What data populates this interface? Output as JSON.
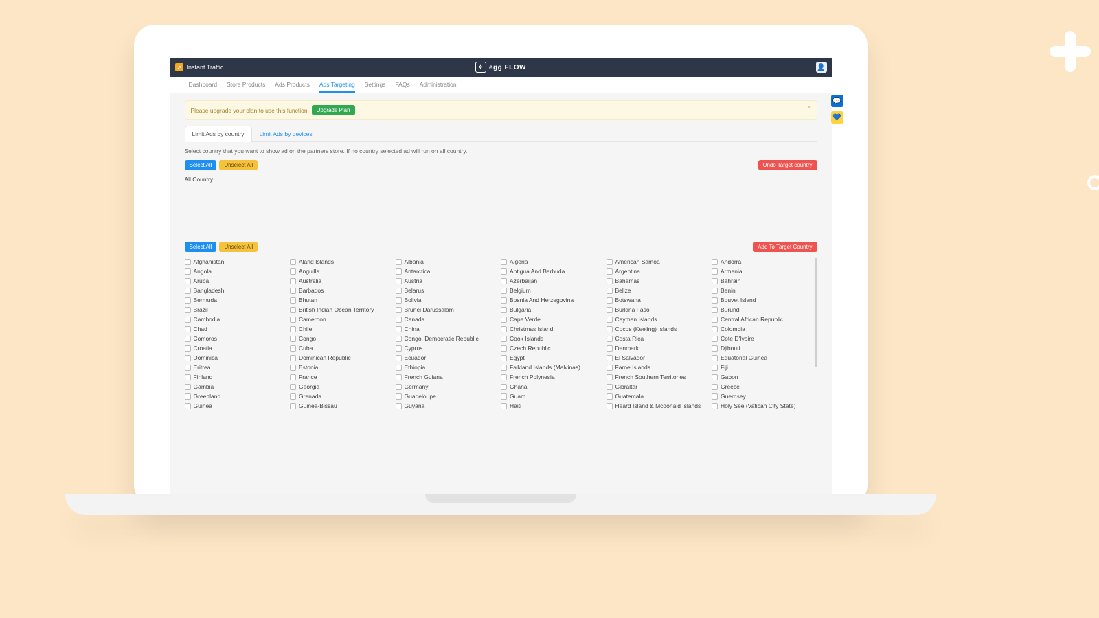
{
  "topbar": {
    "app_name": "Instant Traffic",
    "logo_text": "egg FLOW"
  },
  "nav": {
    "items": [
      {
        "label": "Dashboard"
      },
      {
        "label": "Store Products"
      },
      {
        "label": "Ads Products"
      },
      {
        "label": "Ads Targeting",
        "active": true
      },
      {
        "label": "Settings"
      },
      {
        "label": "FAQs"
      },
      {
        "label": "Administration"
      }
    ]
  },
  "alert": {
    "text": "Please upgrade your plan to use this function",
    "upgrade_label": "Upgrade Plan"
  },
  "tabs": [
    {
      "label": "Limit Ads by country",
      "active": true
    },
    {
      "label": "Limit Ads by devices"
    }
  ],
  "info": "Select country that you want to show ad on the partners store. If no country selected ad will run on all country.",
  "buttons": {
    "select_all": "Select All",
    "unselect_all": "Unselect All",
    "undo_target": "Undo Target country",
    "add_target": "Add To Target Country"
  },
  "all_country_label": "All Country",
  "countries_col1": [
    "Afghanistan",
    "Angola",
    "Aruba",
    "Bangladesh",
    "Bermuda",
    "Brazil",
    "Cambodia",
    "Chad",
    "Comoros",
    "Croatia",
    "Dominica",
    "Eritrea",
    "Finland",
    "Gambia",
    "Greenland",
    "Guinea"
  ],
  "countries_col2": [
    "Aland Islands",
    "Anguilla",
    "Australia",
    "Barbados",
    "Bhutan",
    "British Indian Ocean Territory",
    "Cameroon",
    "Chile",
    "Congo",
    "Cuba",
    "Dominican Republic",
    "Estonia",
    "France",
    "Georgia",
    "Grenada",
    "Guinea-Bissau"
  ],
  "countries_col3": [
    "Albania",
    "Antarctica",
    "Austria",
    "Belarus",
    "Bolivia",
    "Brunei Darussalam",
    "Canada",
    "China",
    "Congo, Democratic Republic",
    "Cyprus",
    "Ecuador",
    "Ethiopia",
    "French Guiana",
    "Germany",
    "Guadeloupe",
    "Guyana"
  ],
  "countries_col4": [
    "Algeria",
    "Antigua And Barbuda",
    "Azerbaijan",
    "Belgium",
    "Bosnia And Herzegovina",
    "Bulgaria",
    "Cape Verde",
    "Christmas Island",
    "Cook Islands",
    "Czech Republic",
    "Egypt",
    "Falkland Islands (Malvinas)",
    "French Polynesia",
    "Ghana",
    "Guam",
    "Haiti"
  ],
  "countries_col5": [
    "American Samoa",
    "Argentina",
    "Bahamas",
    "Belize",
    "Botswana",
    "Burkina Faso",
    "Cayman Islands",
    "Cocos (Keeling) Islands",
    "Costa Rica",
    "Denmark",
    "El Salvador",
    "Faroe Islands",
    "French Southern Territories",
    "Gibraltar",
    "Guatemala",
    "Heard Island & Mcdonald Islands"
  ],
  "countries_col6": [
    "Andorra",
    "Armenia",
    "Bahrain",
    "Benin",
    "Bouvet Island",
    "Burundi",
    "Central African Republic",
    "Colombia",
    "Cote D'Ivoire",
    "Djibouti",
    "Equatorial Guinea",
    "Fiji",
    "Gabon",
    "Greece",
    "Guernsey",
    "Holy See (Vatican City State)"
  ]
}
